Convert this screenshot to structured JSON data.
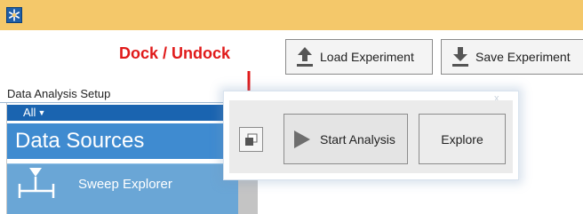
{
  "titlebar": {
    "app_icon": "snowflake-app-icon",
    "color": "#f4c86a"
  },
  "annotation": {
    "text": "Dock / Undock",
    "color": "#e01a1a"
  },
  "toolbar": {
    "load_label": "Load Experiment",
    "load_icon": "upload-arrow-icon",
    "save_label": "Save Experiment",
    "save_icon": "download-arrow-icon"
  },
  "panel": {
    "title": "Data Analysis Setup",
    "filter_label": "All",
    "sources_header": "Data Sources",
    "items": [
      {
        "label": "Sweep Explorer",
        "icon": "sweep-icon"
      }
    ],
    "accent_dark": "#1a64b0",
    "accent": "#3f8bd0",
    "accent_light": "#6aa6d6"
  },
  "floating_toolbar": {
    "close_glyph": "x",
    "dock_icon": "dock-undock-icon",
    "start_label": "Start Analysis",
    "start_icon": "play-icon",
    "explore_label": "Explore"
  }
}
